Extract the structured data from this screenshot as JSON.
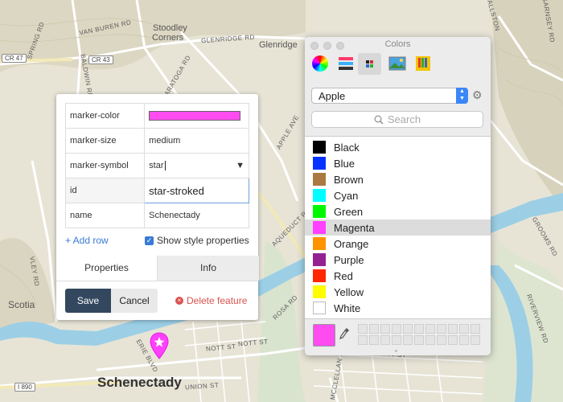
{
  "map": {
    "labels": {
      "van_buren_rd": "VAN BUREN RD",
      "stoodley_corners_1": "Stoodley",
      "stoodley_corners_2": "Corners",
      "glenridge_rd": "GLENRIDGE RD",
      "glenridge": "Glenridge",
      "spring_rd": "SPRING RD",
      "baldwin_rd": "BALDWIN RD",
      "cr47": "CR 47",
      "cr43": "CR 43",
      "saratoga_rd": "SARATOGA RD",
      "apple_ave": "APPLE AVE",
      "aqueduct_rd": "AQUEDUCT RD",
      "rosa_rd": "ROSA RD",
      "vley_rd": "VLEY RD",
      "scotia": "Scotia",
      "erie_blvd": "ERIE BLVD",
      "nott_st_1": "NOTT ST",
      "nott_st_2": "NOTT ST",
      "nott_st_3": "NOTT ST",
      "union_st": "UNION ST",
      "mcclellan_st": "MCCLELLAN ST",
      "i890": "I 890",
      "schenectady": "Schenectady",
      "groom_rd": "GROOMS RD",
      "riverview_rd": "RIVERVIEW RD",
      "garnsey_rd": "GARNSEY RD",
      "b_rd": "BALLSTON"
    }
  },
  "editor": {
    "rows": [
      {
        "key": "marker-color",
        "value": ""
      },
      {
        "key": "marker-size",
        "value": "medium"
      },
      {
        "key": "marker-symbol",
        "value": "star"
      },
      {
        "key": "id",
        "value": "star-stroked"
      },
      {
        "key": "name",
        "value": "Schenectady"
      }
    ],
    "marker_color_hex": "#ff4cf0",
    "select_arrow": "▼",
    "add_row": "+ Add row",
    "show_style": "Show style properties",
    "show_style_checked": true,
    "tabs": {
      "properties": "Properties",
      "info": "Info"
    },
    "save": "Save",
    "cancel": "Cancel",
    "delete": "Delete feature"
  },
  "colors_panel": {
    "title": "Colors",
    "palette": "Apple",
    "search_placeholder": "Search",
    "selected": "Magenta",
    "current_color": "#ff4cf0",
    "items": [
      {
        "name": "Black",
        "color": "#000000"
      },
      {
        "name": "Blue",
        "color": "#0433ff"
      },
      {
        "name": "Brown",
        "color": "#aa7942"
      },
      {
        "name": "Cyan",
        "color": "#00fdff"
      },
      {
        "name": "Green",
        "color": "#00f900"
      },
      {
        "name": "Magenta",
        "color": "#ff40ff"
      },
      {
        "name": "Orange",
        "color": "#ff9300"
      },
      {
        "name": "Purple",
        "color": "#942192"
      },
      {
        "name": "Red",
        "color": "#ff2600"
      },
      {
        "name": "Yellow",
        "color": "#fffb00"
      },
      {
        "name": "White",
        "color": "#ffffff"
      }
    ]
  }
}
